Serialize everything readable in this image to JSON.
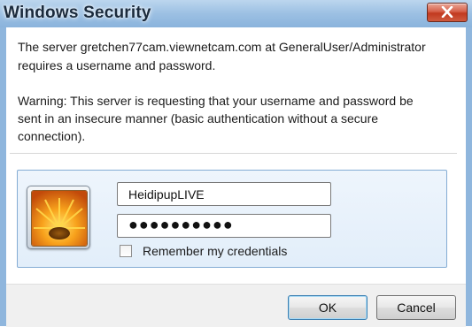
{
  "window": {
    "title": "Windows Security"
  },
  "message": {
    "line1": "The server gretchen77cam.viewnetcam.com at GeneralUser/Administrator",
    "line2": "requires a username and password.",
    "warning1": "Warning: This server is requesting that your username and password be",
    "warning2": "sent in an insecure manner (basic authentication without a secure",
    "warning3": "connection)."
  },
  "credentials": {
    "username": "HeidipupLIVE",
    "password_mask": "●●●●●●●●●●",
    "remember_label": "Remember my credentials",
    "remember_checked": false
  },
  "buttons": {
    "ok": "OK",
    "cancel": "Cancel"
  },
  "icons": {
    "close": "close-icon",
    "avatar": "user-tile-flower-icon"
  },
  "colors": {
    "close_button": "#c1391f",
    "tile_border": "#84acd4",
    "default_button_border": "#3c7fb1"
  }
}
